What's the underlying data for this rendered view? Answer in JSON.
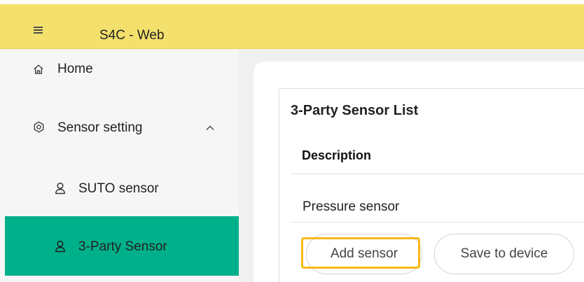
{
  "app": {
    "title": "S4C - Web"
  },
  "sidebar": {
    "items": [
      {
        "label": "Home",
        "icon": "home-icon"
      },
      {
        "label": "Sensor setting",
        "icon": "gear-icon",
        "expanded": true
      },
      {
        "label": "SUTO sensor",
        "icon": "user-icon"
      },
      {
        "label": "3-Party Sensor",
        "icon": "user-icon",
        "selected": true
      }
    ]
  },
  "panel": {
    "title": "3-Party Sensor List",
    "columns": [
      "Description"
    ],
    "rows": [
      {
        "description": "Pressure sensor"
      }
    ],
    "buttons": {
      "add": "Add sensor",
      "save": "Save to device"
    }
  },
  "colors": {
    "header_bg": "#f3e06d",
    "active_item_bg": "#00b08b",
    "highlight_border": "#f6b917"
  }
}
